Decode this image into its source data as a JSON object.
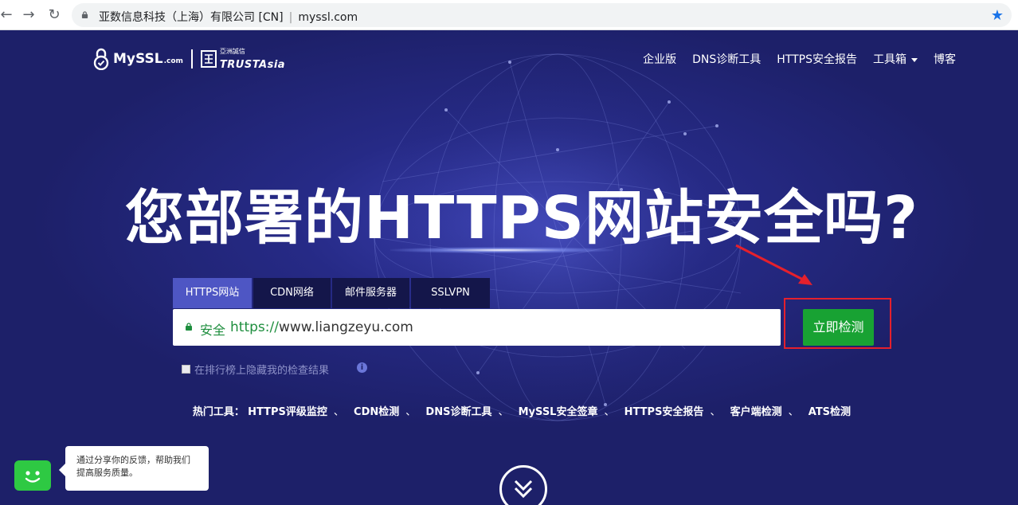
{
  "browser": {
    "site_identity": "亚数信息科技（上海）有限公司 [CN]",
    "separator": "|",
    "url": "myssl.com"
  },
  "logo": {
    "brand": "MySSL",
    "brand_suffix": ".com",
    "partner_cn": "亞洲誠信",
    "partner": "TRUSTAsia"
  },
  "nav": {
    "items": [
      {
        "label": "企业版"
      },
      {
        "label": "DNS诊断工具"
      },
      {
        "label": "HTTPS安全报告"
      },
      {
        "label": "工具箱"
      },
      {
        "label": "博客"
      }
    ]
  },
  "headline": "您部署的HTTPS网站安全吗?",
  "tabs": [
    {
      "label": "HTTPS网站",
      "active": true
    },
    {
      "label": "CDN网络",
      "active": false
    },
    {
      "label": "邮件服务器",
      "active": false
    },
    {
      "label": "SSLVPN",
      "active": false
    }
  ],
  "search": {
    "security_label": "安全",
    "url_scheme": "https://",
    "url_rest": "www.liangzeyu.com",
    "button_label": "立即检测"
  },
  "hide_option": {
    "label": "在排行榜上隐藏我的检查结果",
    "checked": false
  },
  "hot_tools": {
    "label": "热门工具：",
    "items": [
      "HTTPS评级监控",
      "CDN检测",
      "DNS诊断工具",
      "MySSL安全签章",
      "HTTPS安全报告",
      "客户端检测",
      "ATS检测"
    ],
    "separator": "、"
  },
  "feedback": {
    "text": "通过分享你的反馈，帮助我们提高服务质量。"
  },
  "colors": {
    "hero_bg": "#262a86",
    "tab_active": "#4e56c4",
    "tab_inactive": "#14164a",
    "button_green": "#18a233",
    "annotation_red": "#e5202c",
    "secure_green": "#1e8e3e"
  },
  "icons": [
    "back-arrow-icon",
    "forward-arrow-icon",
    "reload-icon",
    "lock-icon",
    "star-icon",
    "info-icon",
    "chat-face-icon",
    "chevron-double-down-icon"
  ]
}
